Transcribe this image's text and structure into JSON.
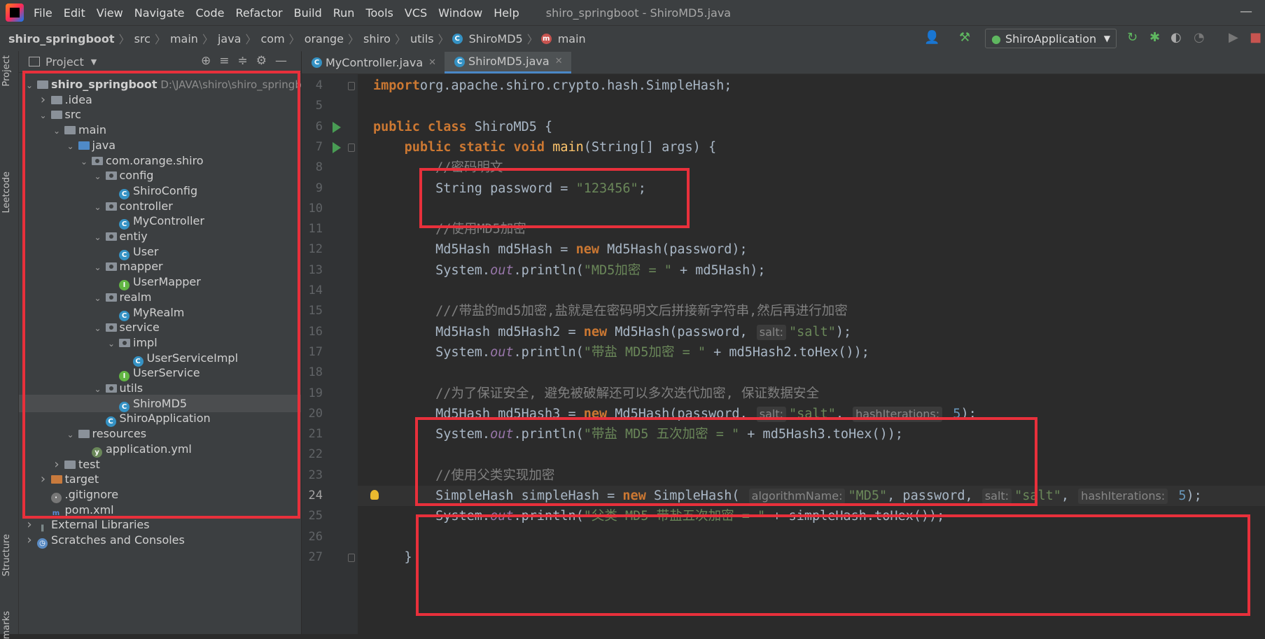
{
  "menubar": {
    "items": [
      "File",
      "Edit",
      "View",
      "Navigate",
      "Code",
      "Refactor",
      "Build",
      "Run",
      "Tools",
      "VCS",
      "Window",
      "Help"
    ],
    "title": "shiro_springboot - ShiroMD5.java"
  },
  "breadcrumb": [
    "shiro_springboot",
    "src",
    "main",
    "java",
    "com",
    "orange",
    "shiro",
    "utils",
    "ShiroMD5",
    "main"
  ],
  "run_config": "ShiroApplication",
  "side_labels": {
    "project": "Project",
    "leetcode": "Leetcode",
    "structure": "Structure",
    "bookmarks": "marks"
  },
  "project_panel": {
    "title": "Project",
    "tree": [
      {
        "label": "shiro_springboot",
        "path": "D:\\JAVA\\shiro\\shiro_springbo",
        "indent": 0,
        "arrow": "v",
        "icon": "folder"
      },
      {
        "label": ".idea",
        "indent": 1,
        "arrow": ">",
        "icon": "folder"
      },
      {
        "label": "src",
        "indent": 1,
        "arrow": "v",
        "icon": "folder"
      },
      {
        "label": "main",
        "indent": 2,
        "arrow": "v",
        "icon": "folder"
      },
      {
        "label": "java",
        "indent": 3,
        "arrow": "v",
        "icon": "folder-blue"
      },
      {
        "label": "com.orange.shiro",
        "indent": 4,
        "arrow": "v",
        "icon": "package"
      },
      {
        "label": "config",
        "indent": 5,
        "arrow": "v",
        "icon": "package"
      },
      {
        "label": "ShiroConfig",
        "indent": 6,
        "arrow": "",
        "icon": "class"
      },
      {
        "label": "controller",
        "indent": 5,
        "arrow": "v",
        "icon": "package"
      },
      {
        "label": "MyController",
        "indent": 6,
        "arrow": "",
        "icon": "class"
      },
      {
        "label": "entiy",
        "indent": 5,
        "arrow": "v",
        "icon": "package"
      },
      {
        "label": "User",
        "indent": 6,
        "arrow": "",
        "icon": "class"
      },
      {
        "label": "mapper",
        "indent": 5,
        "arrow": "v",
        "icon": "package"
      },
      {
        "label": "UserMapper",
        "indent": 6,
        "arrow": "",
        "icon": "interface"
      },
      {
        "label": "realm",
        "indent": 5,
        "arrow": "v",
        "icon": "package"
      },
      {
        "label": "MyRealm",
        "indent": 6,
        "arrow": "",
        "icon": "class"
      },
      {
        "label": "service",
        "indent": 5,
        "arrow": "v",
        "icon": "package"
      },
      {
        "label": "impl",
        "indent": 6,
        "arrow": "v",
        "icon": "package"
      },
      {
        "label": "UserServiceImpl",
        "indent": 7,
        "arrow": "",
        "icon": "class"
      },
      {
        "label": "UserService",
        "indent": 6,
        "arrow": "",
        "icon": "interface"
      },
      {
        "label": "utils",
        "indent": 5,
        "arrow": "v",
        "icon": "package"
      },
      {
        "label": "ShiroMD5",
        "indent": 6,
        "arrow": "",
        "icon": "class",
        "selected": true
      },
      {
        "label": "ShiroApplication",
        "indent": 5,
        "arrow": "",
        "icon": "class"
      },
      {
        "label": "resources",
        "indent": 3,
        "arrow": "v",
        "icon": "folder"
      },
      {
        "label": "application.yml",
        "indent": 4,
        "arrow": "",
        "icon": "yml"
      },
      {
        "label": "test",
        "indent": 2,
        "arrow": ">",
        "icon": "folder"
      },
      {
        "label": "target",
        "indent": 1,
        "arrow": ">",
        "icon": "folder-orange"
      },
      {
        "label": ".gitignore",
        "indent": 1,
        "arrow": "",
        "icon": "file"
      },
      {
        "label": "pom.xml",
        "indent": 1,
        "arrow": "",
        "icon": "maven"
      },
      {
        "label": "External Libraries",
        "indent": 0,
        "arrow": ">",
        "icon": "libs"
      },
      {
        "label": "Scratches and Consoles",
        "indent": 0,
        "arrow": ">",
        "icon": "scratch"
      }
    ]
  },
  "tabs": [
    {
      "label": "MyController.java",
      "active": false
    },
    {
      "label": "ShiroMD5.java",
      "active": true
    }
  ],
  "code": {
    "current_line": 24,
    "lines": [
      {
        "n": 4,
        "tokens": [
          [
            "kw",
            "import"
          ],
          [
            "",
            "org.apache.shiro.crypto.hash.SimpleHash;"
          ]
        ]
      },
      {
        "n": 5,
        "tokens": []
      },
      {
        "n": 6,
        "tokens": [
          [
            "kw",
            "public class "
          ],
          [
            "",
            "ShiroMD5 {"
          ]
        ]
      },
      {
        "n": 7,
        "tokens": [
          [
            "",
            "    "
          ],
          [
            "kw",
            "public static void "
          ],
          [
            "cn",
            "main"
          ],
          [
            "",
            "(String[] args) {"
          ]
        ]
      },
      {
        "n": 8,
        "tokens": [
          [
            "",
            "        "
          ],
          [
            "cmt",
            "//密码明文"
          ]
        ]
      },
      {
        "n": 9,
        "tokens": [
          [
            "",
            "        String password = "
          ],
          [
            "str",
            "\"123456\""
          ],
          [
            "",
            ";"
          ]
        ]
      },
      {
        "n": 10,
        "tokens": []
      },
      {
        "n": 11,
        "tokens": [
          [
            "",
            "        "
          ],
          [
            "cmt",
            "//使用MD5加密"
          ]
        ]
      },
      {
        "n": 12,
        "tokens": [
          [
            "",
            "        Md5Hash md5Hash = "
          ],
          [
            "kw",
            "new "
          ],
          [
            "",
            "Md5Hash(password);"
          ]
        ]
      },
      {
        "n": 13,
        "tokens": [
          [
            "",
            "        System."
          ],
          [
            "field",
            "out"
          ],
          [
            "",
            ".println("
          ],
          [
            "str",
            "\"MD5加密 = \""
          ],
          [
            "",
            " + md5Hash);"
          ]
        ]
      },
      {
        "n": 14,
        "tokens": []
      },
      {
        "n": 15,
        "tokens": [
          [
            "",
            "        "
          ],
          [
            "cmt",
            "///带盐的md5加密,盐就是在密码明文后拼接新字符串,然后再进行加密"
          ]
        ]
      },
      {
        "n": 16,
        "tokens": [
          [
            "",
            "        Md5Hash md5Hash2 = "
          ],
          [
            "kw",
            "new "
          ],
          [
            "",
            "Md5Hash(password, "
          ],
          [
            "hint",
            "salt:"
          ],
          [
            "str",
            "\"salt\""
          ],
          [
            "",
            ");"
          ]
        ]
      },
      {
        "n": 17,
        "tokens": [
          [
            "",
            "        System."
          ],
          [
            "field",
            "out"
          ],
          [
            "",
            ".println("
          ],
          [
            "str",
            "\"带盐 MD5加密 = \""
          ],
          [
            "",
            " + md5Hash2.toHex());"
          ]
        ]
      },
      {
        "n": 18,
        "tokens": []
      },
      {
        "n": 19,
        "tokens": [
          [
            "",
            "        "
          ],
          [
            "cmt",
            "//为了保证安全, 避免被破解还可以多次迭代加密, 保证数据安全"
          ]
        ]
      },
      {
        "n": 20,
        "tokens": [
          [
            "",
            "        Md5Hash md5Hash3 = "
          ],
          [
            "kw",
            "new "
          ],
          [
            "",
            "Md5Hash(password, "
          ],
          [
            "hint",
            "salt:"
          ],
          [
            "str",
            "\"salt\""
          ],
          [
            "",
            ", "
          ],
          [
            "hint",
            "hashIterations:"
          ],
          [
            "num",
            " 5"
          ],
          [
            "",
            ");"
          ]
        ]
      },
      {
        "n": 21,
        "tokens": [
          [
            "",
            "        System."
          ],
          [
            "field",
            "out"
          ],
          [
            "",
            ".println("
          ],
          [
            "str",
            "\"带盐 MD5 五次加密 = \""
          ],
          [
            "",
            " + md5Hash3.toHex());"
          ]
        ]
      },
      {
        "n": 22,
        "tokens": []
      },
      {
        "n": 23,
        "tokens": [
          [
            "",
            "        "
          ],
          [
            "cmt",
            "//使用父类实现加密"
          ]
        ]
      },
      {
        "n": 24,
        "tokens": [
          [
            "",
            "        SimpleHash simpleHash = "
          ],
          [
            "kw",
            "new "
          ],
          [
            "",
            "SimpleHash( "
          ],
          [
            "hint",
            "algorithmName:"
          ],
          [
            "str",
            "\"MD5\""
          ],
          [
            "",
            ", password, "
          ],
          [
            "hint",
            "salt:"
          ],
          [
            "str",
            "\"salt\""
          ],
          [
            "",
            ", "
          ],
          [
            "hint",
            "hashIterations:"
          ],
          [
            "num",
            " 5"
          ],
          [
            "",
            ");"
          ]
        ]
      },
      {
        "n": 25,
        "tokens": [
          [
            "",
            "        System."
          ],
          [
            "field",
            "out"
          ],
          [
            "",
            ".println("
          ],
          [
            "str",
            "\"父类 MD5 带盐五次加密 = \""
          ],
          [
            "",
            " + simpleHash.toHex());"
          ]
        ]
      },
      {
        "n": 26,
        "tokens": []
      },
      {
        "n": 27,
        "tokens": [
          [
            "",
            "    }"
          ]
        ]
      }
    ]
  },
  "colors": {
    "highlight_box": "#e8303b",
    "accent": "#4a88c7"
  }
}
